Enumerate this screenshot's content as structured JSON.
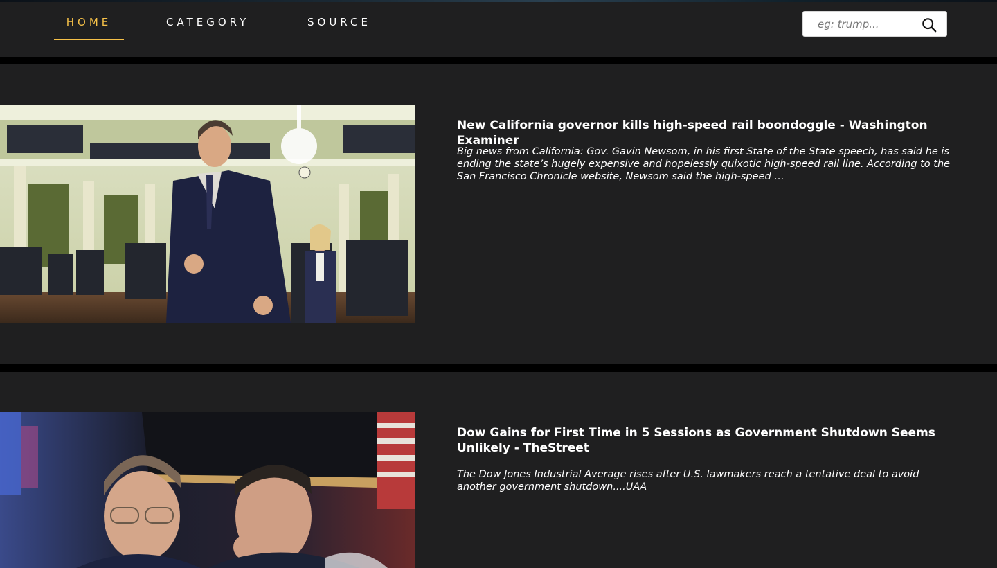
{
  "nav": {
    "items": [
      {
        "label": "HOME",
        "active": true
      },
      {
        "label": "CATEGORY",
        "active": false
      },
      {
        "label": "SOURCE",
        "active": false
      }
    ],
    "accent_color": "#f5c048"
  },
  "search": {
    "placeholder": "eg: trump...",
    "value": "",
    "icon": "search-icon"
  },
  "articles": [
    {
      "title": "New California governor kills high-speed rail boondoggle - Washington Examiner",
      "description": "Big news from California: Gov. Gavin Newsom, in his first State of the State speech, has said he is ending the state’s hugely expensive and hopelessly quixotic high-speed rail line. According to the San Francisco Chronicle website, Newsom said the high-speed …",
      "image_alt": "Photo of a man in a dark suit walking through an applauding legislative chamber"
    },
    {
      "title": "Dow Gains for First Time in 5 Sessions as Government Shutdown Seems Unlikely - TheStreet",
      "description": "The Dow Jones Industrial Average rises after U.S. lawmakers reach a tentative deal to avoid another government shutdown....UAA",
      "image_alt": "Photo of two traders looking at screens on a stock exchange floor"
    }
  ],
  "colors": {
    "page_background": "#000000",
    "card_background": "#1f1f20",
    "text": "#ffffff"
  }
}
